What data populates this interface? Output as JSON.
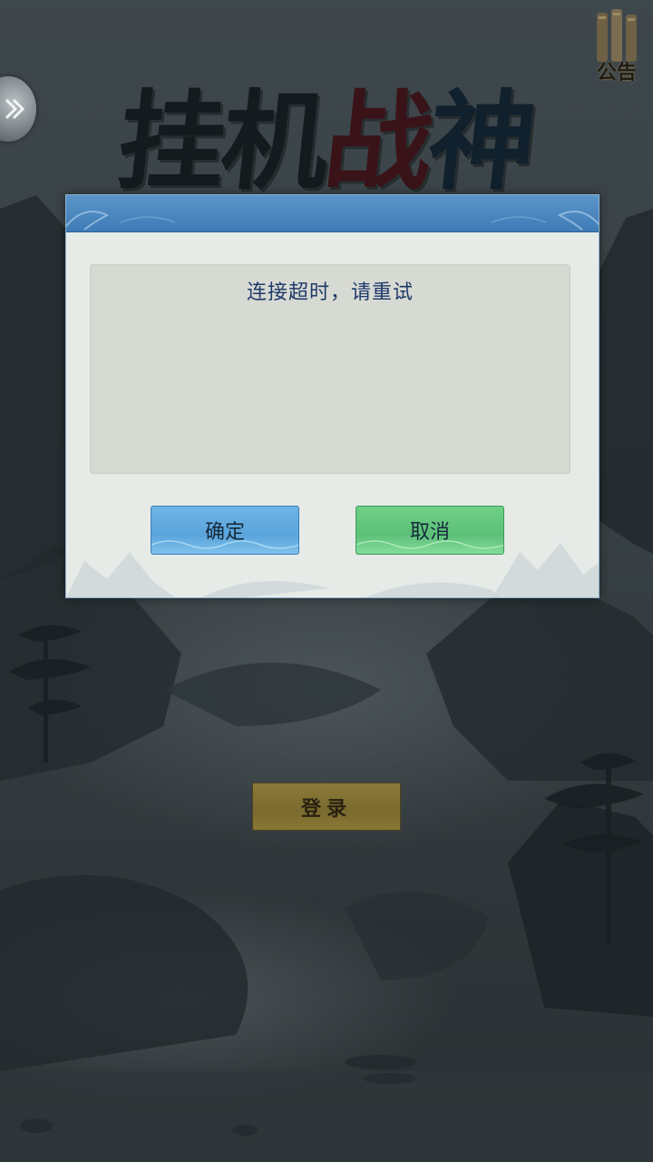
{
  "title": {
    "chars": [
      "挂",
      "机",
      "战",
      "神"
    ]
  },
  "notice": {
    "label": "公告",
    "icon": "scroll-icon"
  },
  "back": {
    "icon": "double-chevron-right-icon"
  },
  "dialog": {
    "message": "连接超时，请重试",
    "confirm_label": "确定",
    "cancel_label": "取消"
  },
  "login": {
    "label": "登录"
  },
  "colors": {
    "dialog_header": "#4a86c0",
    "confirm_button": "#62ace0",
    "cancel_button": "#66c77f",
    "login_button": "#857333",
    "message_text": "#1f3a6a"
  }
}
